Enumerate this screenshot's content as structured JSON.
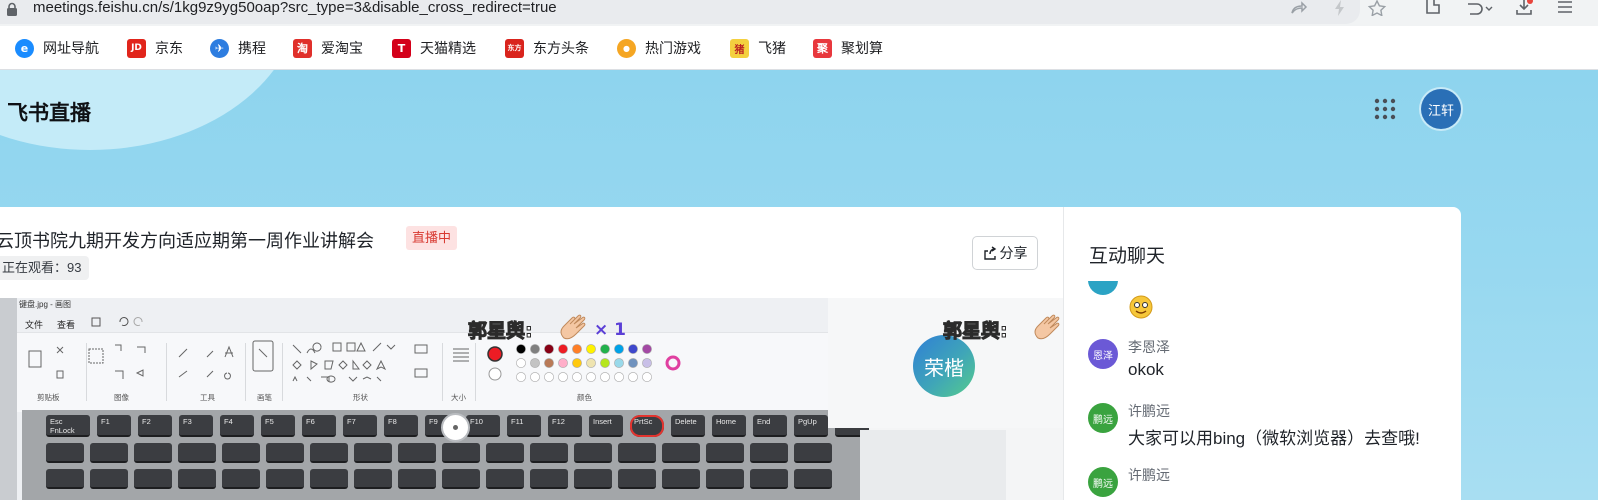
{
  "browser": {
    "url": "meetings.feishu.cn/s/1kg9z9yg50oap?src_type=3&disable_cross_redirect=true",
    "bookmarks": [
      {
        "label": "网址导航",
        "icon": "e-browser-icon",
        "glyph": "e",
        "color": "#1a8cff"
      },
      {
        "label": "京东",
        "icon": "jd-icon",
        "glyph": "JD",
        "color": "#e1251b"
      },
      {
        "label": "携程",
        "icon": "ctrip-icon",
        "glyph": "✈",
        "color": "#2d7de0"
      },
      {
        "label": "爱淘宝",
        "icon": "taobao-icon",
        "glyph": "淘",
        "color": "#e0302b"
      },
      {
        "label": "天猫精选",
        "icon": "tmall-icon",
        "glyph": "T",
        "color": "#d4001a"
      },
      {
        "label": "东方头条",
        "icon": "dftt-icon",
        "glyph": "东方",
        "color": "#d9241d"
      },
      {
        "label": "热门游戏",
        "icon": "game-icon",
        "glyph": "●",
        "color": "#f5a623"
      },
      {
        "label": "飞猪",
        "icon": "fliggy-icon",
        "glyph": "猪",
        "color": "#f4d03f"
      },
      {
        "label": "聚划算",
        "icon": "juhuasuan-icon",
        "glyph": "聚",
        "color": "#e8383d"
      }
    ]
  },
  "header": {
    "title": "飞书直播",
    "user_avatar": "江轩"
  },
  "live": {
    "title": "云顶书院九期开发方向适应期第一周作业讲解会",
    "status_badge": "直播中",
    "viewers": "正在观看：93",
    "share_label": "分享"
  },
  "stage": {
    "paint_title": "键盘.jpg - 画图",
    "menu": [
      "文件",
      "查看"
    ],
    "groups": [
      "剪贴板",
      "图像",
      "工具",
      "画笔",
      "形状",
      "大小",
      "颜色"
    ],
    "reaction_left": {
      "name": "郭星舆:",
      "count": "× 1"
    },
    "reaction_right": {
      "name": "郭星舆:"
    },
    "camera_avatar": "荣楷",
    "keys_row1": [
      "Esc FnLock",
      "F1",
      "F2",
      "F3",
      "F4",
      "F5",
      "F6",
      "F7",
      "F8",
      "F9",
      "F10",
      "F11",
      "F12",
      "Insert",
      "PrtSc",
      "Delete",
      "Home",
      "End",
      "PgUp",
      "PgDn"
    ],
    "palette": [
      "#000000",
      "#7f7f7f",
      "#880015",
      "#ed1c24",
      "#ff7f27",
      "#fff200",
      "#22b14c",
      "#00a2e8",
      "#3f48cc",
      "#a349a4",
      "#ffffff",
      "#c3c3c3",
      "#b97a57",
      "#ffaec9",
      "#ffc90e",
      "#efe4b0",
      "#b5e61d",
      "#99d9ea",
      "#7092be",
      "#c8bfe7"
    ]
  },
  "chat": {
    "title": "互动聊天",
    "messages": [
      {
        "name": "李恩泽",
        "avatar": "恩泽",
        "text": "okok",
        "color": "#6b59d6"
      },
      {
        "name": "许鹏远",
        "avatar": "鹏远",
        "text": "大家可以用bing（微软浏览器）去查哦!",
        "color": "#3aa33f"
      },
      {
        "name": "许鹏远",
        "avatar": "鹏远",
        "text": "",
        "color": "#3aa33f"
      }
    ]
  }
}
